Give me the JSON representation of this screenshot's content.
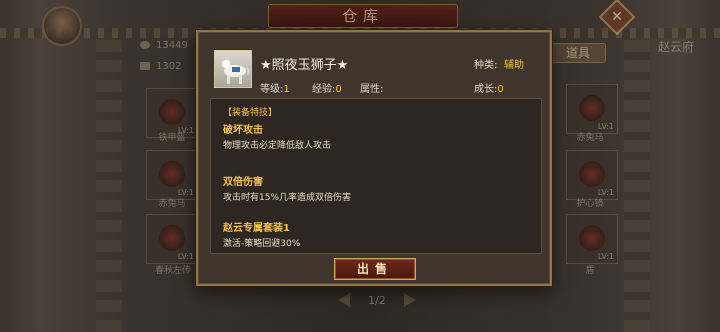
{
  "background": {
    "window_title": "仓库",
    "close_symbol": "✕",
    "hero_name": "赵云府",
    "gold": "13449",
    "silver": "1302",
    "tab_props": "道具",
    "pager": "1/2",
    "slots": [
      {
        "label": "铁甲盔",
        "level": "LV:1"
      },
      {
        "label": "赤兔马",
        "level": "LV:1"
      },
      {
        "label": "春秋左传",
        "level": "LV:1"
      },
      {
        "label": "赤兔马",
        "level": "LV:1"
      },
      {
        "label": "护心镜",
        "level": "LV:1"
      },
      {
        "label": "盾",
        "level": "LV:1"
      }
    ]
  },
  "item": {
    "icon": "jade-lion-horse-icon",
    "name": "★照夜玉狮子★",
    "type_label": "种类:",
    "type_value": "辅助",
    "level_label": "等级:",
    "level_value": "1",
    "exp_label": "经验:",
    "exp_value": "0",
    "attr_label": "属性:",
    "attr_value": "",
    "growth_label": "成长:",
    "growth_value": "0"
  },
  "section_title": "【装备特技】",
  "skills": [
    {
      "name": "破坏攻击",
      "desc": "物理攻击必定降低敌人攻击"
    },
    {
      "name": "双倍伤害",
      "desc": "攻击时有15%几率造成双倍伤害"
    },
    {
      "name": "赵云专属套装1",
      "desc": "激活-策略回避30%"
    }
  ],
  "sell_label": "出售",
  "colors": {
    "accent_gold": "#f3c24a",
    "panel_border": "#8f7548",
    "button_red": "#6e2a18"
  }
}
